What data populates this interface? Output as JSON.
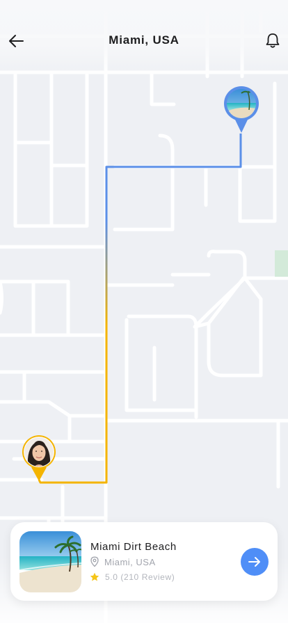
{
  "header": {
    "title": "Miami, USA",
    "back_icon": "arrow-left-icon",
    "notification_icon": "bell-icon"
  },
  "map": {
    "destination_marker": "beach-thumbnail-marker",
    "origin_marker": "user-avatar-marker",
    "route_colors": {
      "start": "#f4b400",
      "end": "#5b8fe8"
    }
  },
  "place_card": {
    "name": "Miami Dirt Beach",
    "location": "Miami, USA",
    "location_icon": "location-pin-icon",
    "rating_icon": "star-icon",
    "rating_text": "5.0 (210 Review)",
    "go_icon": "arrow-right-icon",
    "accent": "#4f8ef7",
    "star_color": "#f5c518"
  }
}
